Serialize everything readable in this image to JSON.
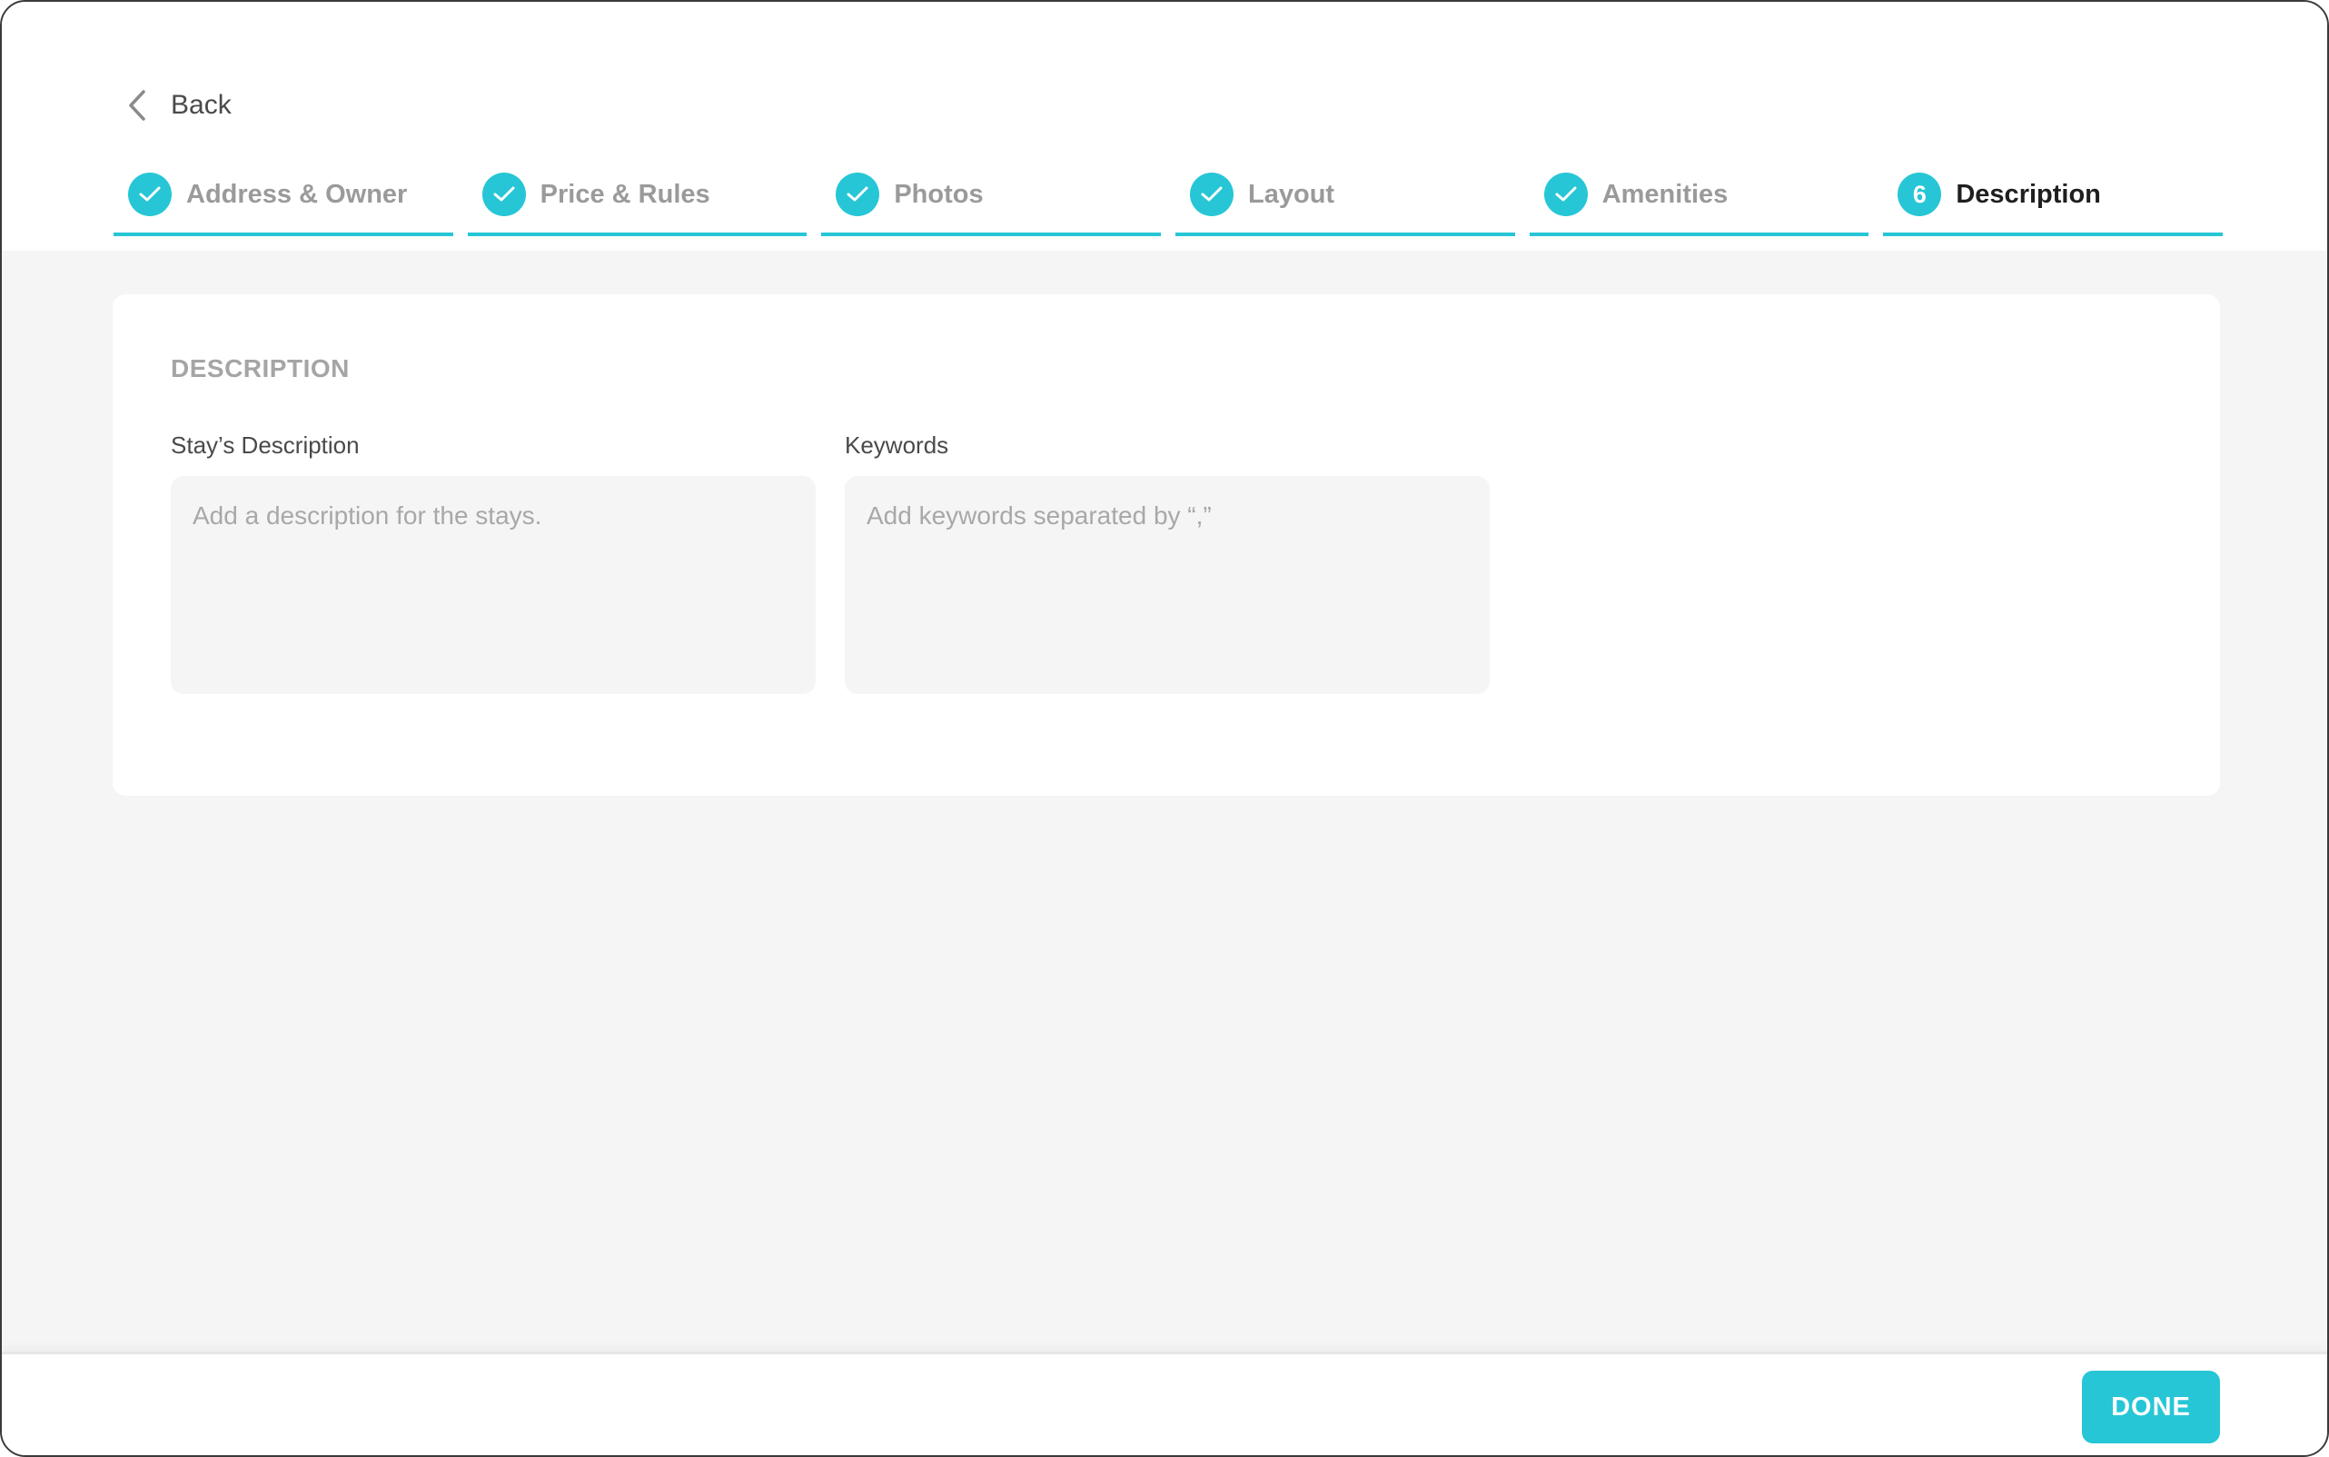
{
  "header": {
    "back_label": "Back"
  },
  "steps": [
    {
      "label": "Address & Owner",
      "status": "complete",
      "icon": "check-icon"
    },
    {
      "label": "Price & Rules",
      "status": "complete",
      "icon": "check-icon"
    },
    {
      "label": "Photos",
      "status": "complete",
      "icon": "check-icon"
    },
    {
      "label": "Layout",
      "status": "complete",
      "icon": "check-icon"
    },
    {
      "label": "Amenities",
      "status": "complete",
      "icon": "check-icon"
    },
    {
      "label": "Description",
      "status": "active",
      "number": "6"
    }
  ],
  "main": {
    "section_title": "DESCRIPTION",
    "description_field": {
      "label": "Stay’s Description",
      "value": "",
      "placeholder": "Add a description for the stays."
    },
    "keywords_field": {
      "label": "Keywords",
      "value": "",
      "placeholder": "Add keywords separated by “,”"
    }
  },
  "footer": {
    "done_label": "DONE"
  },
  "colors": {
    "accent": "#26c6d6",
    "background": "#f5f5f5",
    "muted_text": "#9a9a9a",
    "active_text": "#1f1f1f"
  }
}
